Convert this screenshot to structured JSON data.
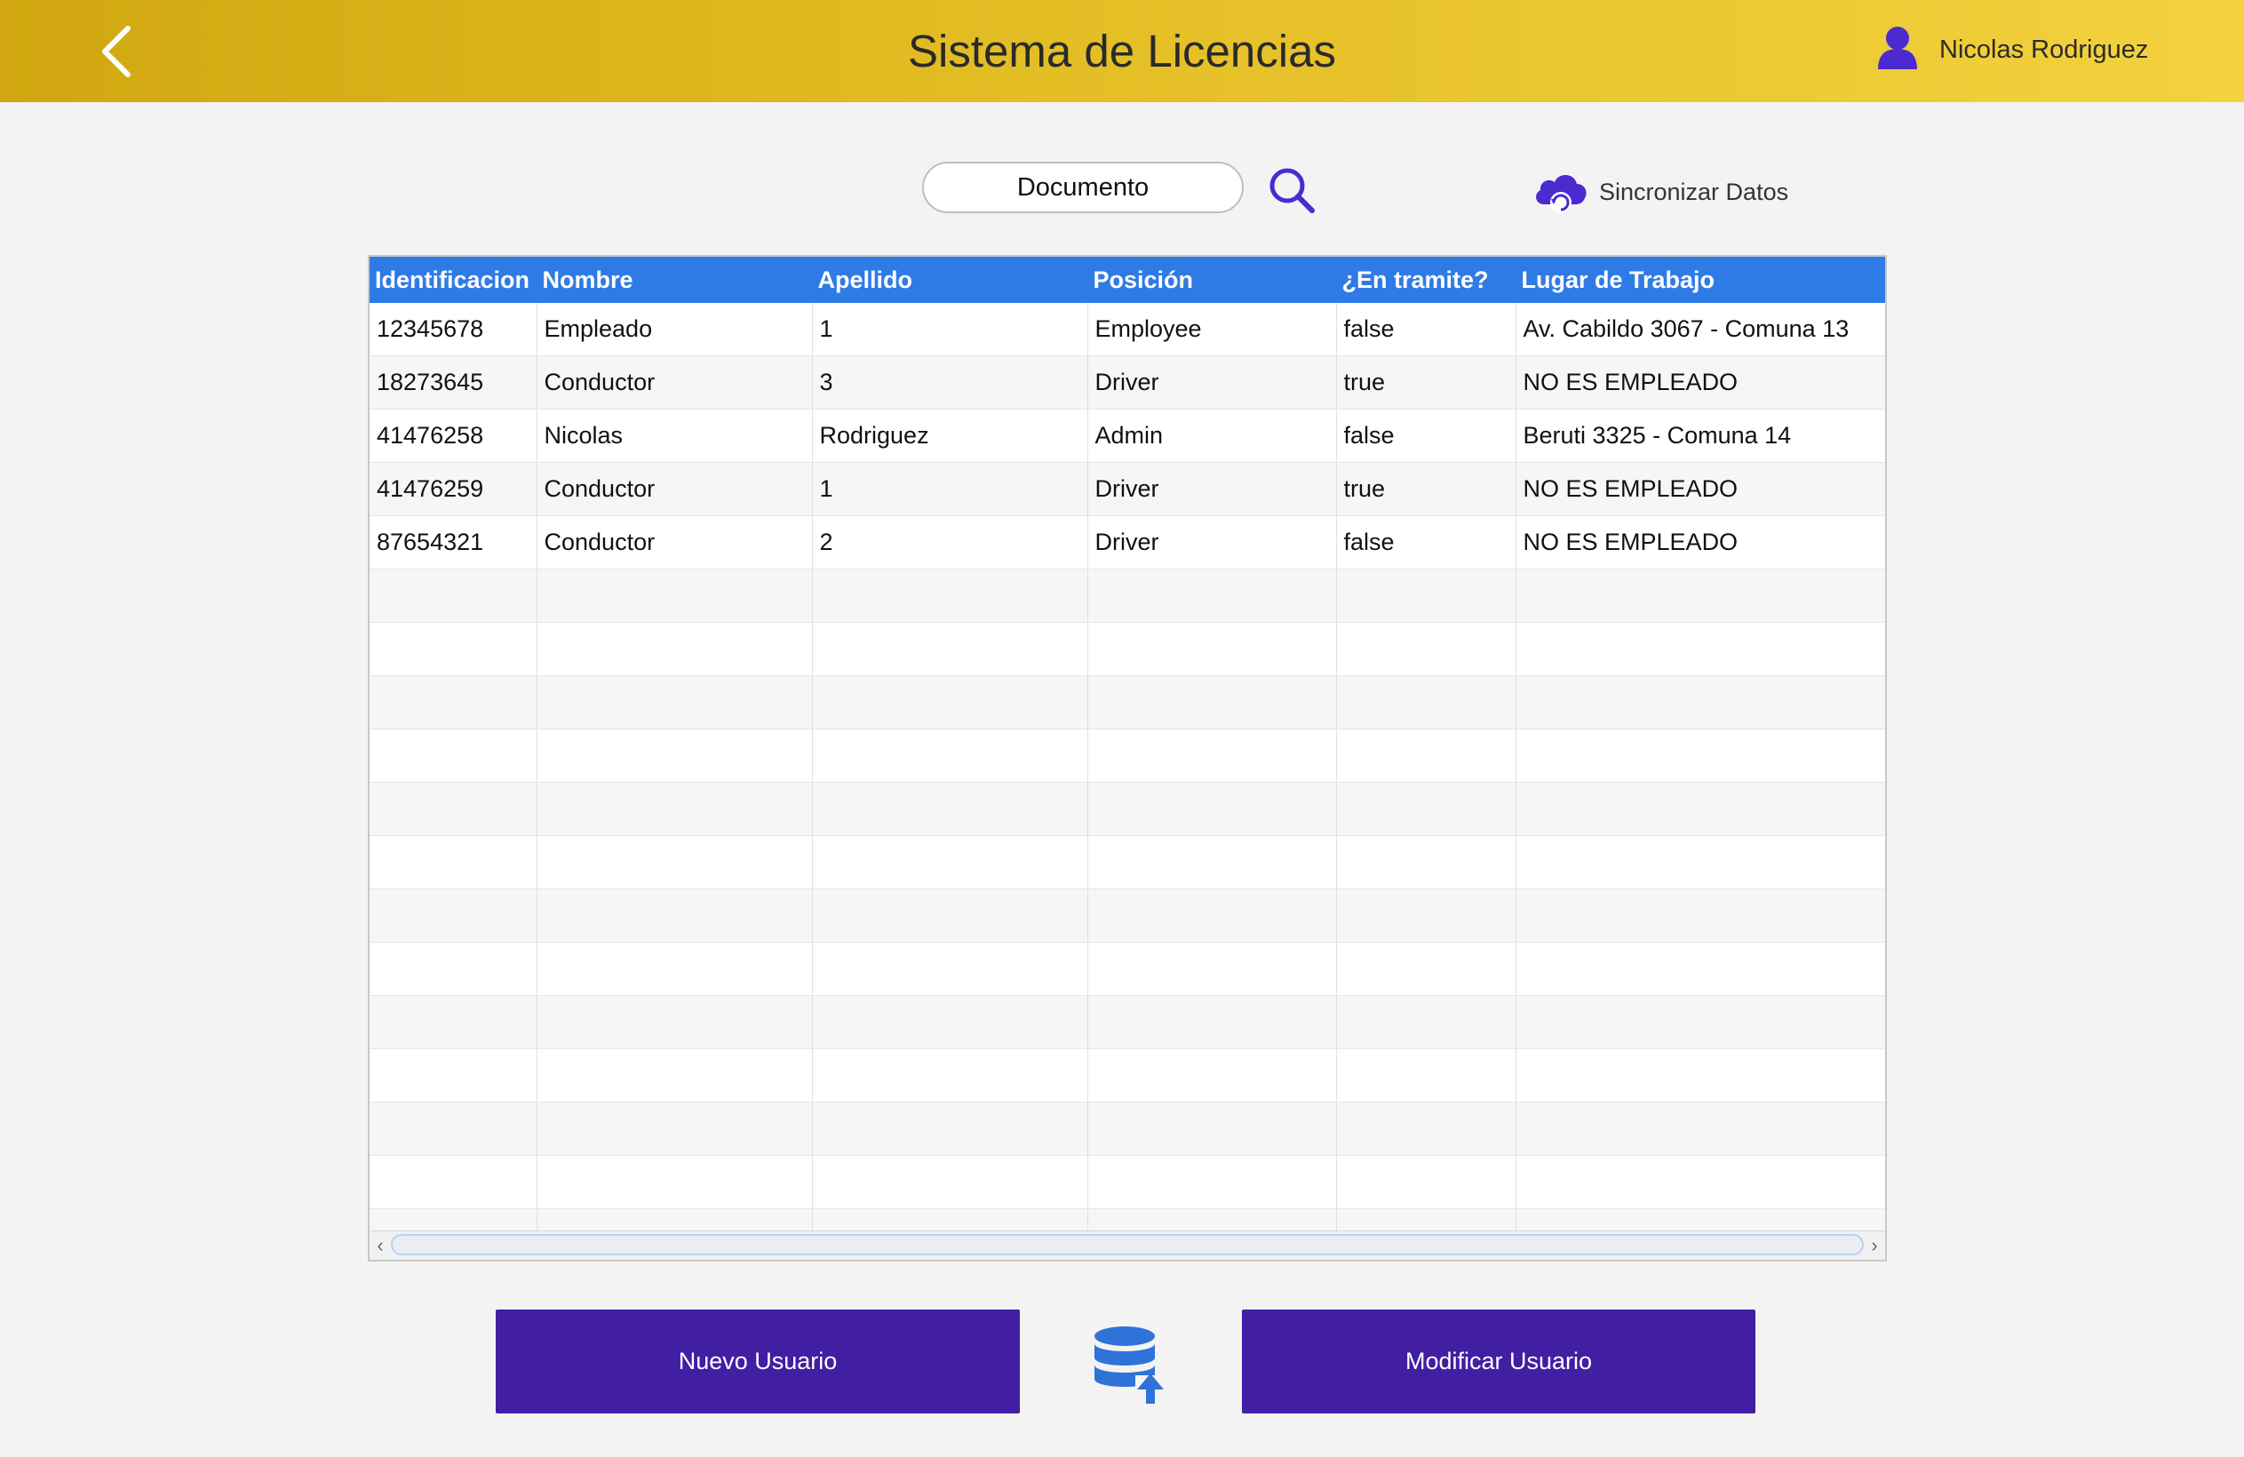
{
  "header": {
    "title": "Sistema de Licencias",
    "user_name": "Nicolas Rodriguez",
    "back_icon": "chevron-left-icon",
    "user_icon": "user-icon"
  },
  "search": {
    "placeholder": "Documento",
    "search_icon": "search-icon"
  },
  "sync": {
    "label": "Sincronizar Datos",
    "icon": "cloud-sync-icon"
  },
  "table": {
    "columns": [
      "Identificacion",
      "Nombre",
      "Apellido",
      "Posición",
      "¿En tramite?",
      "Lugar de Trabajo"
    ],
    "rows": [
      [
        "12345678",
        "Empleado",
        "1",
        "Employee",
        "false",
        "Av. Cabildo 3067 - Comuna 13"
      ],
      [
        "18273645",
        "Conductor",
        "3",
        "Driver",
        "true",
        "NO ES EMPLEADO"
      ],
      [
        "41476258",
        "Nicolas",
        "Rodriguez",
        "Admin",
        "false",
        "Beruti 3325 - Comuna 14"
      ],
      [
        "41476259",
        "Conductor",
        "1",
        "Driver",
        "true",
        "NO ES EMPLEADO"
      ],
      [
        "87654321",
        "Conductor",
        "2",
        "Driver",
        "false",
        "NO ES EMPLEADO"
      ]
    ]
  },
  "actions": {
    "new_user": "Nuevo Usuario",
    "modify_user": "Modificar Usuario",
    "db_icon": "database-upload-icon"
  },
  "colors": {
    "header_gradient_start": "#d0a710",
    "header_gradient_end": "#f3d23e",
    "table_header": "#2f7be6",
    "button": "#421ea3",
    "icon_accent": "#4b2bd0"
  }
}
